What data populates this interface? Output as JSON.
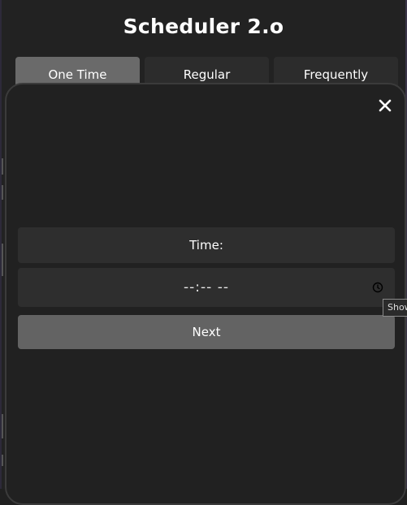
{
  "app": {
    "title": "Scheduler 2.o"
  },
  "tabs": [
    {
      "label": "One Time",
      "active": true
    },
    {
      "label": "Regular",
      "active": false
    },
    {
      "label": "Frequently",
      "active": false
    }
  ],
  "modal": {
    "close_icon": "close-icon",
    "time_label": "Time:",
    "time_input": {
      "value": "--:-- --",
      "icon": "clock-icon"
    },
    "next_label": "Next"
  },
  "tooltip": {
    "text": "Show"
  },
  "colors": {
    "background": "#222222",
    "tab_active": "#6a6a6a",
    "tab_inactive": "#2c2c2c",
    "field": "#2e2e2e",
    "button": "#636363",
    "text": "#ffffff"
  }
}
